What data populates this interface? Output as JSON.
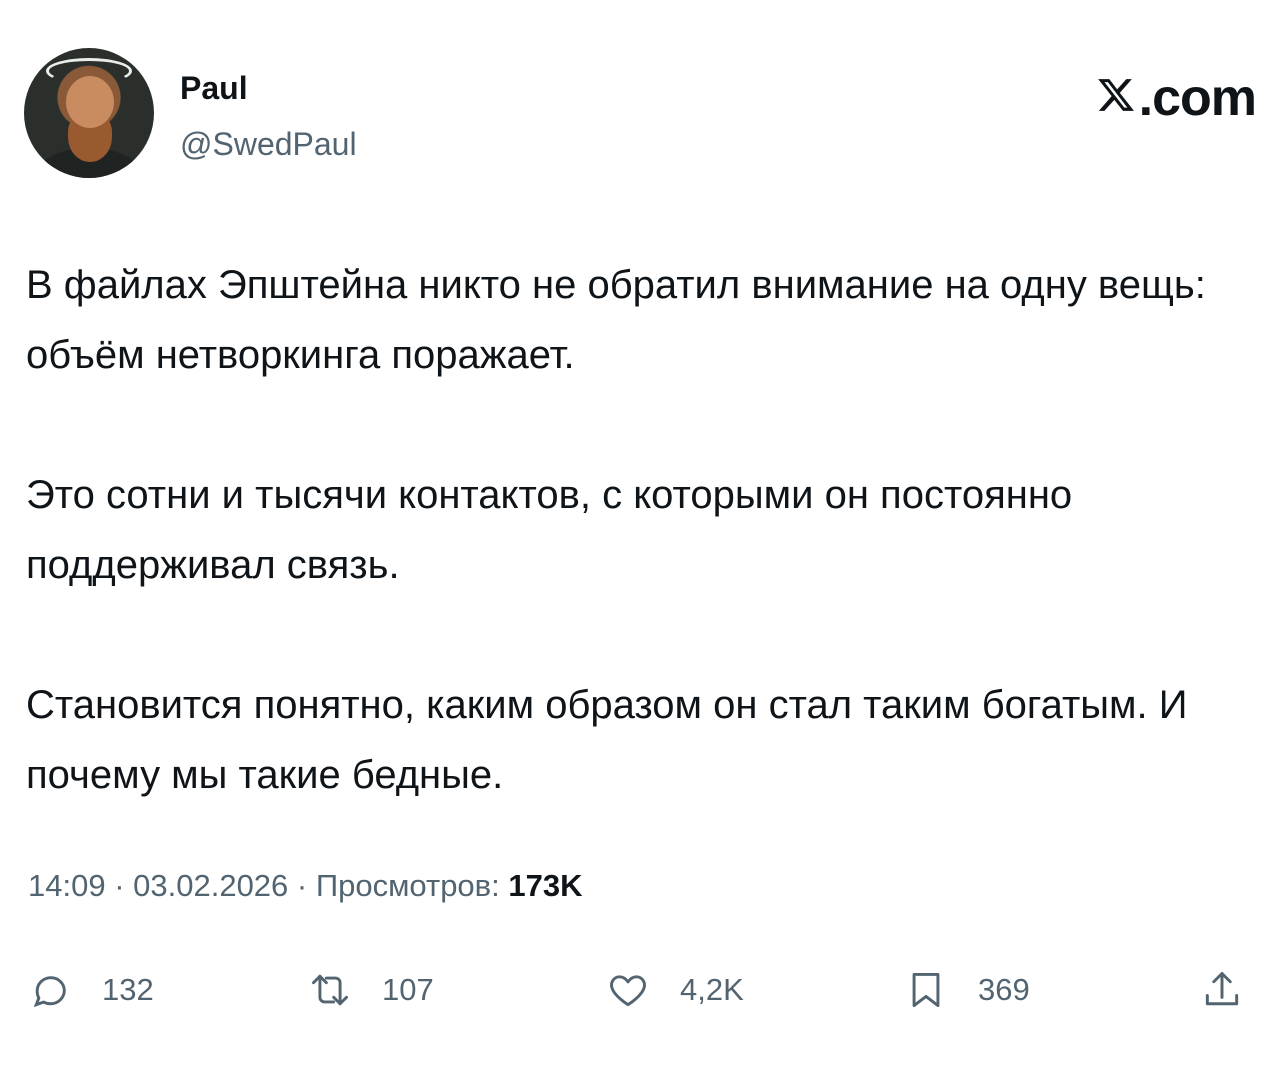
{
  "author": {
    "name": "Paul",
    "handle": "@SwedPaul"
  },
  "brand": {
    "text": ".com",
    "icon": "x-logo-icon"
  },
  "tweet": {
    "paragraphs": [
      "В файлах Эпштейна никто не обратил внимание на одну вещь: объём нетворкинга поражает.",
      "Это сотни и тысячи контактов, с которыми он постоянно поддерживал связь.",
      "Становится понятно, каким образом он стал таким богатым. И почему мы такие бедные."
    ]
  },
  "meta": {
    "time": "14:09",
    "separator": " · ",
    "date": "03.02.2026",
    "views_label": "Просмотров: ",
    "views_count": "173K"
  },
  "actions": {
    "reply": {
      "icon": "reply-icon",
      "count": "132"
    },
    "retweet": {
      "icon": "retweet-icon",
      "count": "107"
    },
    "like": {
      "icon": "heart-icon",
      "count": "4,2K"
    },
    "bookmark": {
      "icon": "bookmark-icon",
      "count": "369"
    },
    "share": {
      "icon": "share-icon"
    }
  },
  "colors": {
    "text": "#0f1419",
    "secondary": "#536471",
    "background": "#ffffff"
  }
}
